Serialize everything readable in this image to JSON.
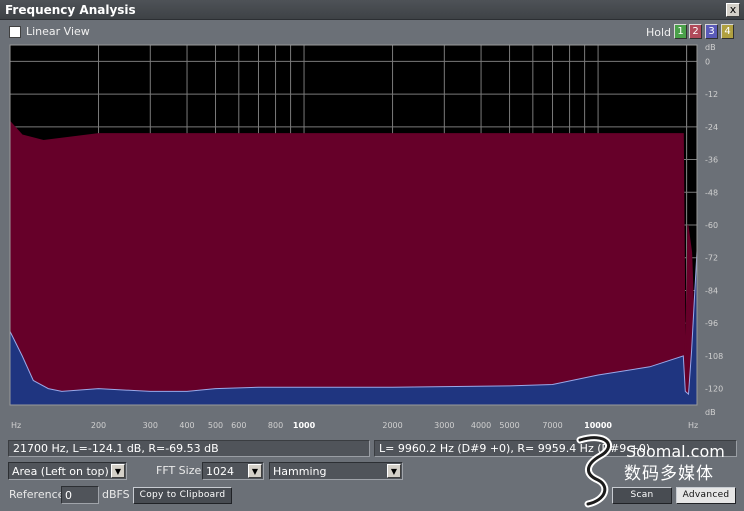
{
  "window": {
    "title": "Frequency Analysis",
    "close_glyph": "x"
  },
  "toolbar": {
    "linear_view_label": "Linear View",
    "hold_label": "Hold",
    "hold_buttons": [
      {
        "label": "1",
        "color": "#4aa04a"
      },
      {
        "label": "2",
        "color": "#b04a5a"
      },
      {
        "label": "3",
        "color": "#5a5ab8"
      },
      {
        "label": "4",
        "color": "#b0a040"
      }
    ]
  },
  "chart_data": {
    "type": "area",
    "x_scale": "log",
    "x_unit_label": "Hz",
    "y_unit_label": "dB",
    "x_ticks": [
      "200",
      "300",
      "400",
      "500",
      "600",
      "800",
      "1000",
      "2000",
      "3000",
      "4000",
      "5000",
      "7000",
      "10000"
    ],
    "y_ticks": [
      "0",
      "-12",
      "-24",
      "-36",
      "-48",
      "-60",
      "-72",
      "-84",
      "-96",
      "-108",
      "-120"
    ],
    "ylim": [
      -126,
      6
    ],
    "background": "#000000",
    "grid": true,
    "series": [
      {
        "channel": "left",
        "color": "#660029",
        "x": [
          100,
          110,
          130,
          200,
          400,
          1000,
          3000,
          10000,
          19500,
          19800,
          20200,
          20800,
          21700
        ],
        "y": [
          -22,
          -27,
          -29,
          -26.5,
          -26.5,
          -26.5,
          -26.5,
          -26.5,
          -26.5,
          -115,
          -60,
          -70,
          -124.1
        ]
      },
      {
        "channel": "right",
        "color": "#1f3580",
        "x": [
          100,
          110,
          120,
          135,
          150,
          200,
          300,
          400,
          500,
          700,
          1000,
          2000,
          5000,
          7000,
          10000,
          15000,
          19500,
          19800,
          20300,
          20800,
          21700
        ],
        "y": [
          -99,
          -108,
          -117,
          -120,
          -121,
          -120,
          -121,
          -121,
          -120,
          -119.5,
          -119.5,
          -119.5,
          -119,
          -118.5,
          -115,
          -112,
          -108,
          -121,
          -122,
          -106,
          -69.53
        ]
      }
    ]
  },
  "readouts": {
    "cursor": "21700 Hz, L=-124.1 dB, R=-69.53 dB",
    "peak": "L= 9960.2 Hz (D#9 +0), R= 9959.4 Hz (D#9 +0)"
  },
  "controls": {
    "graph_mode_value": "Area (Left on top)",
    "fft_size_label": "FFT Size",
    "fft_size_value": "1024",
    "window_value": "Hamming",
    "reference_label": "Reference",
    "reference_value": "0",
    "reference_unit": "dBFS",
    "copy_button": "Copy to Clipboard",
    "scan_button": "Scan",
    "advanced_button": "Advanced"
  },
  "watermark": {
    "site": "Soomal.com",
    "tagline": "数码多媒体"
  }
}
